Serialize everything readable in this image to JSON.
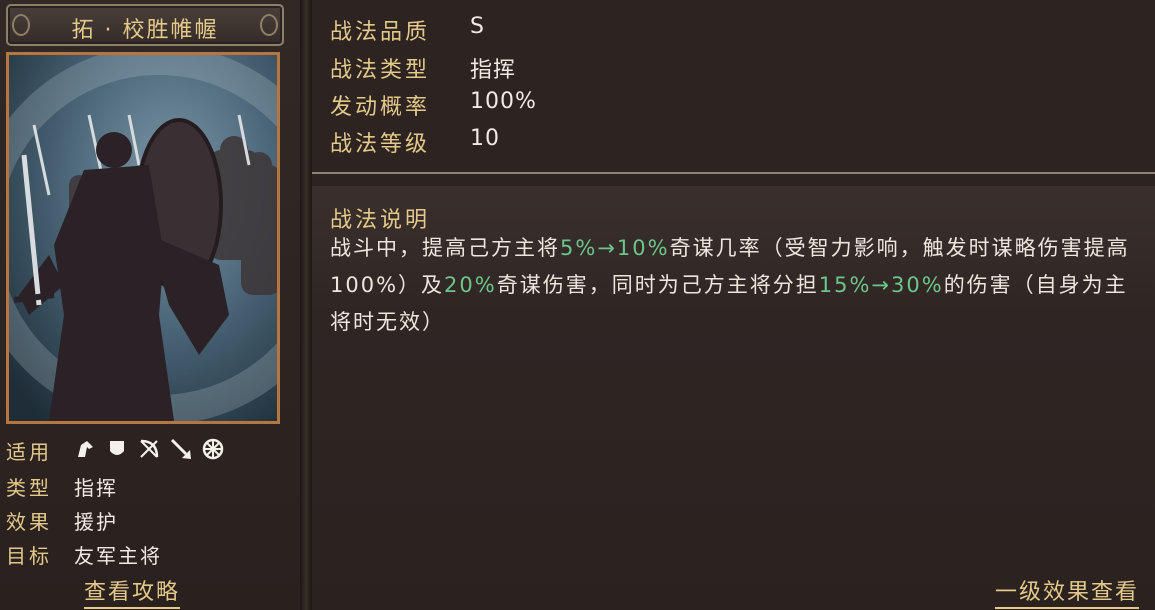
{
  "skill": {
    "name": "拓 · 校胜帷幄"
  },
  "attributes": {
    "applicable_label": "适用",
    "applicable_icons": [
      "cavalry-icon",
      "shield-icon",
      "bow-icon",
      "spear-icon",
      "wheel-icon"
    ],
    "type_label": "类型",
    "type_value": "指挥",
    "effect_label": "效果",
    "effect_value": "援护",
    "target_label": "目标",
    "target_value": "友军主将"
  },
  "links": {
    "guide": "查看攻略",
    "level_effect": "一级效果查看"
  },
  "stats": [
    {
      "label": "战法品质",
      "value": "S"
    },
    {
      "label": "战法类型",
      "value": "指挥"
    },
    {
      "label": "发动概率",
      "value": "100%"
    },
    {
      "label": "战法等级",
      "value": "10"
    }
  ],
  "description": {
    "title": "战法说明",
    "seg1": "战斗中，提高己方主将",
    "hl1": "5%→10%",
    "seg2": "奇谋几率（受智力影响，触发时谋略伤害提高100%）及",
    "hl2": "20%",
    "seg3": "奇谋伤害，同时为己方主将分担",
    "hl3": "15%→30%",
    "seg4": "的伤害（自身为主将时无效）"
  },
  "colors": {
    "gold": "#e3c98a",
    "highlight_green": "#6cc58a",
    "frame_orange": "#b5773f"
  }
}
